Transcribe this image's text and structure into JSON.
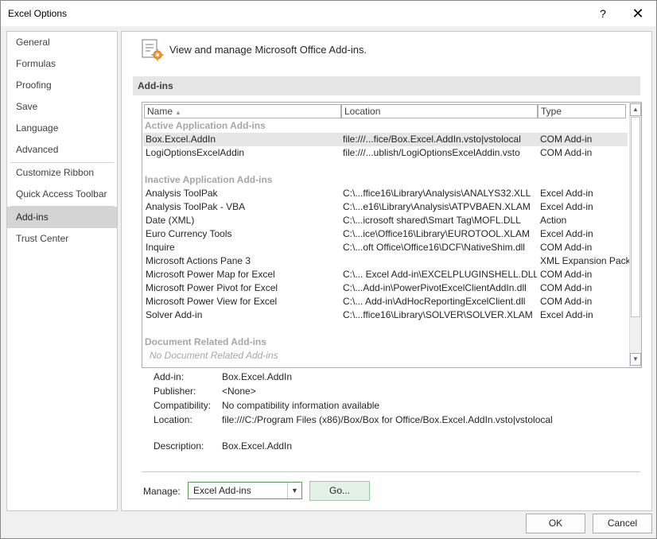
{
  "window": {
    "title": "Excel Options",
    "help_glyph": "?",
    "close_glyph": "✕"
  },
  "sidebar": {
    "items": [
      {
        "label": "General"
      },
      {
        "label": "Formulas"
      },
      {
        "label": "Proofing"
      },
      {
        "label": "Save"
      },
      {
        "label": "Language"
      },
      {
        "label": "Advanced"
      },
      {
        "label": "Customize Ribbon"
      },
      {
        "label": "Quick Access Toolbar"
      },
      {
        "label": "Add-ins",
        "selected": true
      },
      {
        "label": "Trust Center"
      }
    ]
  },
  "header": {
    "text": "View and manage Microsoft Office Add-ins.",
    "icon": "addins-gear-icon"
  },
  "section": {
    "title": "Add-ins"
  },
  "table": {
    "columns": {
      "name": "Name",
      "location": "Location",
      "type": "Type"
    },
    "groups": {
      "active": "Active Application Add-ins",
      "inactive": "Inactive Application Add-ins",
      "document": "Document Related Add-ins",
      "document_empty": "No Document Related Add-ins"
    },
    "active_rows": [
      {
        "name": "Box.Excel.AddIn",
        "location": "file:///...fice/Box.Excel.AddIn.vsto|vstolocal",
        "type": "COM Add-in",
        "selected": true
      },
      {
        "name": "LogiOptionsExcelAddin",
        "location": "file:///...ublish/LogiOptionsExcelAddin.vsto",
        "type": "COM Add-in"
      }
    ],
    "inactive_rows": [
      {
        "name": "Analysis ToolPak",
        "location": "C:\\...ffice16\\Library\\Analysis\\ANALYS32.XLL",
        "type": "Excel Add-in"
      },
      {
        "name": "Analysis ToolPak - VBA",
        "location": "C:\\...e16\\Library\\Analysis\\ATPVBAEN.XLAM",
        "type": "Excel Add-in"
      },
      {
        "name": "Date (XML)",
        "location": "C:\\...icrosoft shared\\Smart Tag\\MOFL.DLL",
        "type": "Action"
      },
      {
        "name": "Euro Currency Tools",
        "location": "C:\\...ice\\Office16\\Library\\EUROTOOL.XLAM",
        "type": "Excel Add-in"
      },
      {
        "name": "Inquire",
        "location": "C:\\...oft Office\\Office16\\DCF\\NativeShim.dll",
        "type": "COM Add-in"
      },
      {
        "name": "Microsoft Actions Pane 3",
        "location": "",
        "type": "XML Expansion Pack"
      },
      {
        "name": "Microsoft Power Map for Excel",
        "location": "C:\\... Excel Add-in\\EXCELPLUGINSHELL.DLL",
        "type": "COM Add-in"
      },
      {
        "name": "Microsoft Power Pivot for Excel",
        "location": "C:\\...Add-in\\PowerPivotExcelClientAddIn.dll",
        "type": "COM Add-in"
      },
      {
        "name": "Microsoft Power View for Excel",
        "location": "C:\\... Add-in\\AdHocReportingExcelClient.dll",
        "type": "COM Add-in"
      },
      {
        "name": "Solver Add-in",
        "location": "C:\\...ffice16\\Library\\SOLVER\\SOLVER.XLAM",
        "type": "Excel Add-in"
      }
    ],
    "scroll_up_glyph": "▲",
    "scroll_down_glyph": "▼",
    "sort_glyph": "▲"
  },
  "details": {
    "addin_label": "Add-in:",
    "addin_value": "Box.Excel.AddIn",
    "publisher_label": "Publisher:",
    "publisher_value": "<None>",
    "compat_label": "Compatibility:",
    "compat_value": "No compatibility information available",
    "location_label": "Location:",
    "location_value": "file:///C:/Program Files (x86)/Box/Box for Office/Box.Excel.AddIn.vsto|vstolocal",
    "description_label": "Description:",
    "description_value": "Box.Excel.AddIn"
  },
  "manage": {
    "label": "Manage:",
    "value": "Excel Add-ins",
    "go_label": "Go...",
    "drop_glyph": "▼"
  },
  "buttons": {
    "ok": "OK",
    "cancel": "Cancel"
  }
}
